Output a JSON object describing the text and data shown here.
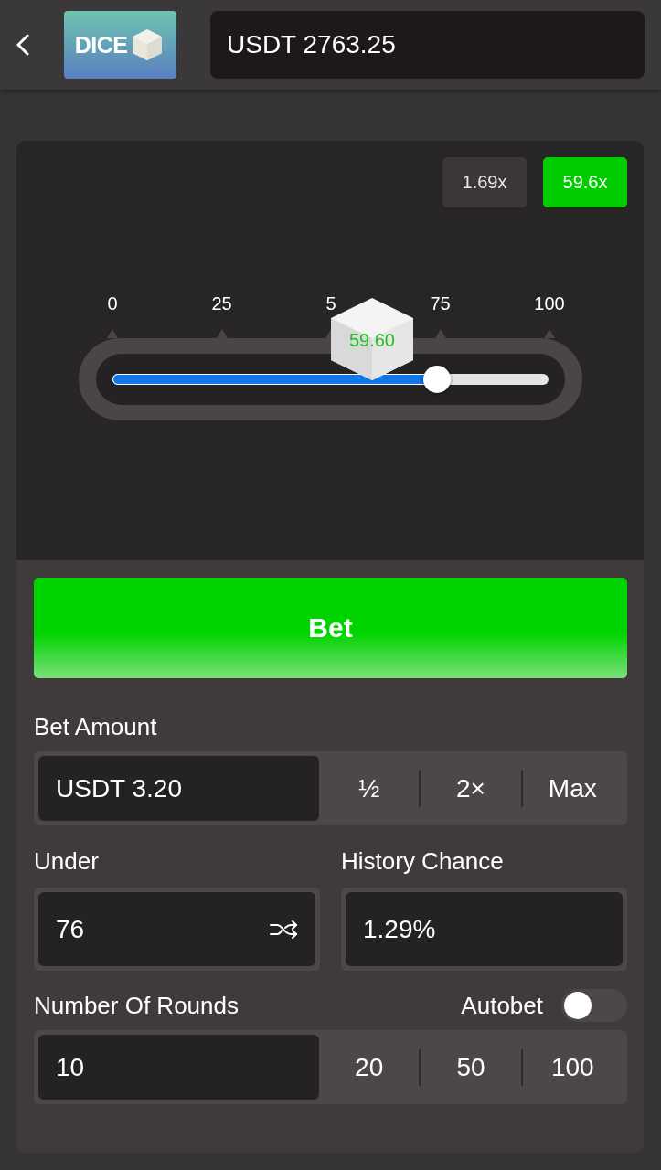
{
  "header": {
    "logo_text": "DICE",
    "balance": "USDT 2763.25"
  },
  "multipliers": [
    {
      "label": "1.69x",
      "selected": false
    },
    {
      "label": "59.6x",
      "selected": true
    }
  ],
  "slider": {
    "ticks": [
      "0",
      "25",
      "5",
      "75",
      "100"
    ],
    "level": 0.745,
    "result": "59.60"
  },
  "bet_button": "Bet",
  "bet_amount": {
    "label": "Bet Amount",
    "value": "USDT 3.20",
    "options": [
      "½",
      "2×",
      "Max"
    ]
  },
  "under": {
    "label": "Under",
    "value": "76"
  },
  "history_chance": {
    "label": "History Chance",
    "value": "1.29%"
  },
  "rounds": {
    "label": "Number Of Rounds",
    "value": "10",
    "options": [
      "20",
      "50",
      "100"
    ]
  },
  "autobet": {
    "label": "Autobet",
    "on": false
  }
}
